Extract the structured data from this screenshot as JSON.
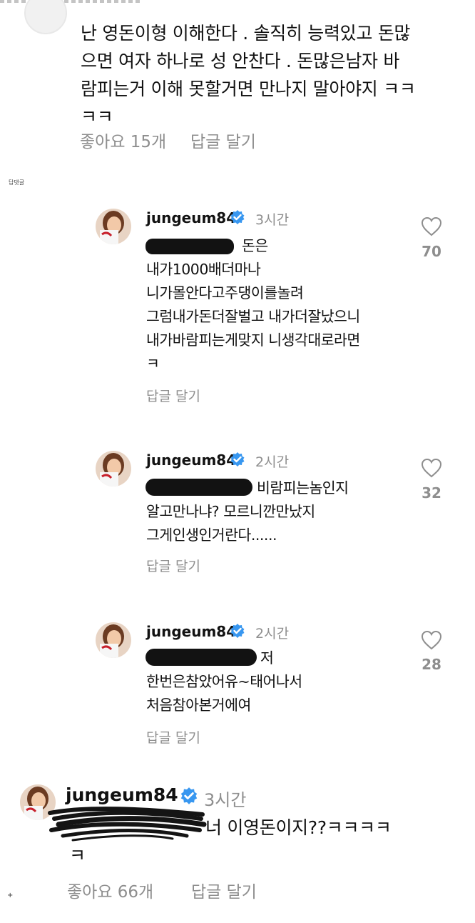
{
  "top_comment": {
    "lines": [
      "난 영돈이형 이해한다 . 솔직히 능력있고 돈많",
      "으면 여자 하나로 성 안찬다 .  돈많은남자 바",
      "람피는거 이해 못할거면 만나지 말아야지 ㅋㅋ",
      "ㅋㅋ"
    ],
    "likes": "좋아요 15개",
    "reply": "답글 달기"
  },
  "reply_section_label": "답댓글",
  "replies": [
    {
      "username": "jungeum84",
      "time": "3시간",
      "lines": [
        "돈은",
        "내가1000배더마나",
        "니가몰안다고주댕이를놀려",
        "그럼내가돈더잘벌고 내가더잘났으니",
        "내가바람피는게맞지 니생각대로라면",
        "ㅋ"
      ],
      "reply": "답글 달기",
      "like_count": "70"
    },
    {
      "username": "jungeum84",
      "time": "2시간",
      "lines": [
        "비람피는놈인지",
        "알고만나냐? 모르니깐만났지",
        "그게인생인거란다......"
      ],
      "reply": "답글 달기",
      "like_count": "32"
    },
    {
      "username": "jungeum84",
      "time": "2시간",
      "lines": [
        "저",
        "한번은참았어유~태어나서",
        "처음참아본거에여"
      ],
      "reply": "답글 달기",
      "like_count": "28"
    }
  ],
  "bottom_comment": {
    "username": "jungeum84",
    "time": "3시간",
    "lines": [
      "너 이영돈이지??ㅋㅋㅋㅋ",
      "ㅋ"
    ],
    "likes": "좋아요 66개",
    "reply": "답글 달기"
  },
  "footer_mark": "+",
  "colors": {
    "text": "#111111",
    "meta": "#8e8e8e",
    "verified": "#3897f0",
    "redaction": "#121212"
  },
  "icons": {
    "verified": "verified-badge-icon",
    "like": "heart-outline-icon"
  }
}
